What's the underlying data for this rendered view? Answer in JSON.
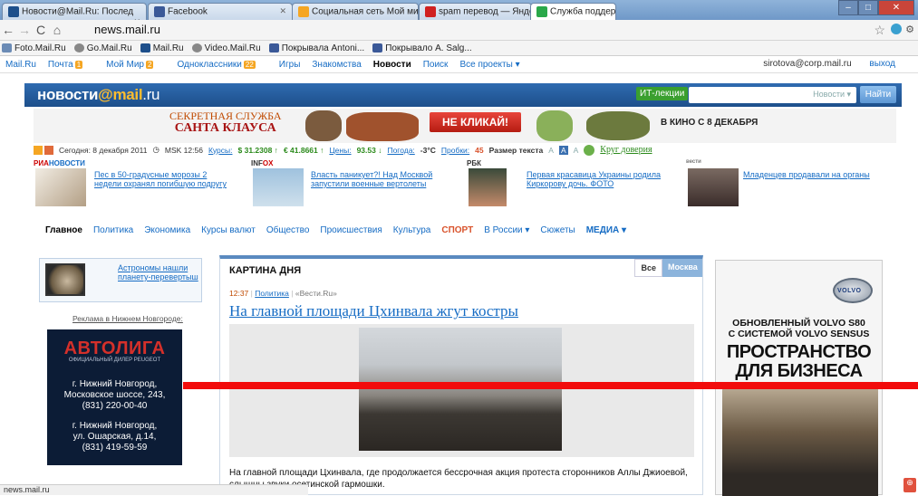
{
  "browser": {
    "tabs": [
      {
        "title": "Новости@Mail.Ru: Послед",
        "color": "#1d4f8b",
        "active": false
      },
      {
        "title": "Facebook",
        "color": "#3b5998",
        "active": false
      },
      {
        "title": "Социальная сеть Мой мир",
        "color": "#f5a623",
        "active": false
      },
      {
        "title": "spam перевод — Яндекс:",
        "color": "#d02020",
        "active": false
      },
      {
        "title": "Служба поддержки",
        "color": "#2aa84a",
        "active": true
      }
    ],
    "url": "news.mail.ru",
    "bookmarks": [
      "Foto.Mail.Ru",
      "Go.Mail.Ru",
      "Mail.Ru",
      "Video.Mail.Ru",
      "Покрывала Antoni...",
      "Покрывало A. Salg..."
    ],
    "status": "news.mail.ru"
  },
  "portal": {
    "items": [
      "Mail.Ru",
      "Почта",
      "Мой Мир",
      "Одноклассники",
      "Игры",
      "Знакомства",
      "Новости",
      "Поиск",
      "Все проекты ▾"
    ],
    "badges": {
      "mail": "1",
      "mymir": "2",
      "ok": "22"
    },
    "user": "sirotova@corp.mail.ru",
    "logout": "выход"
  },
  "header": {
    "logo_a": "новости",
    "logo_b": "@mail",
    "logo_c": ".ru",
    "it_label": "ИТ-лекции",
    "search_scope": "Новости ▾",
    "search_button": "Найти"
  },
  "banner": {
    "line1": "СЕКРЕТНАЯ СЛУЖБА",
    "line2": "САНТА КЛАУСА",
    "button": "НЕ КЛИКАЙ!",
    "right": "В КИНО С 8 ДЕКАБРЯ"
  },
  "infobar": {
    "today": "Сегодня: 8 декабря 2011",
    "msk": "MSK 12:56",
    "rates": "Курсы:",
    "usd": "$ 31.2308 ↑",
    "eur": "€ 41.8661 ↑",
    "prices": "Цены:",
    "oil": "93.53 ↓",
    "weather": "Погода:",
    "temp": "-3°C",
    "traffic": "Пробки:",
    "traffic_val": "45",
    "textsize": "Размер текста",
    "sizes": [
      "A",
      "A",
      "A"
    ],
    "trust": "Круг доверия"
  },
  "news_row": [
    {
      "source_a": "РИА",
      "source_b": "НОВОСТИ",
      "text": "Пес в 50-градусные морозы 2 недели охранял погибшую подругу"
    },
    {
      "source_a": "INF",
      "source_b": "OX",
      "text": "Власть паникует?! Над Москвой запустили военные вертолеты"
    },
    {
      "source_a": "РБК",
      "source_b": "",
      "text": "Первая красавица Украины родила Киркорову дочь. ФОТО"
    },
    {
      "source_a": "вести",
      "source_b": "",
      "text": "Младенцев продавали на органы"
    }
  ],
  "menu": [
    "Главное",
    "Политика",
    "Экономика",
    "Курсы валют",
    "Общество",
    "Происшествия",
    "Культура",
    "СПОРТ",
    "В России ▾",
    "Сюжеты",
    "МЕДИА ▾"
  ],
  "left": {
    "astro": "Астрономы нашли планету-перевертыш",
    "ad_label": "Реклама в Нижнем Новгороде:",
    "avto_title": "АВТОЛИГА",
    "avto_sub": "ОФИЦИАЛЬНЫЙ ДИЛЕР PEUGEOT",
    "addr1": [
      "г. Нижний Новгород,",
      "Московское шоссе, 243,",
      "(831) 220-00-40"
    ],
    "addr2": [
      "г. Нижний Новгород,",
      "ул. Ошарская, д.14,",
      "(831) 419-59-59"
    ]
  },
  "main": {
    "title": "КАРТИНА ДНЯ",
    "tab_all": "Все",
    "tab_moscow": "Москва",
    "time": "12:37",
    "category": "Политика",
    "source": "«Вести.Ru»",
    "headline": "На главной площади Цхинвала жгут костры",
    "caption": "На главной площади Цхинвала, где продолжается бессрочная акция протеста сторонников Аллы Джиоевой, слышны звуки осетинской гармошки."
  },
  "right_ad": {
    "brand": "VOLVO",
    "line1": "ОБНОВЛЕННЫЙ VOLVO S80",
    "line2": "С СИСТЕМОЙ VOLVO SENSUS",
    "big1": "ПРОСТРАНСТВО",
    "big2": "ДЛЯ БИЗНЕСА"
  }
}
